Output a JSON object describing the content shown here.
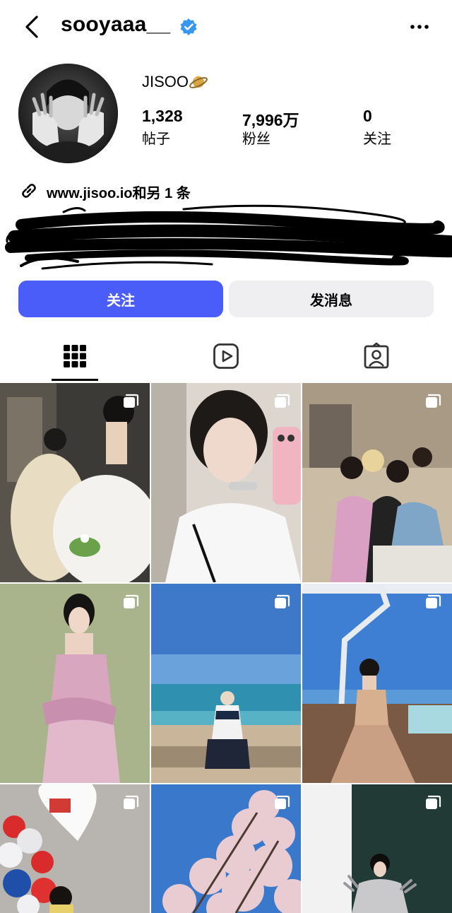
{
  "header": {
    "username": "sooyaaa__",
    "verified": true,
    "icons": [
      "back-arrow-icon",
      "verified-badge-icon",
      "more-options-icon"
    ]
  },
  "profile": {
    "display_name": "JISOO",
    "name_emoji_icon": "planet-icon",
    "stats": [
      {
        "value": "1,328",
        "label": "帖子"
      },
      {
        "value": "7,996万",
        "label": "粉丝"
      },
      {
        "value": "0",
        "label": "关注"
      }
    ],
    "link": "www.jisoo.io和另 1 条",
    "bio": ""
  },
  "actions": {
    "follow_label": "关注",
    "message_label": "发消息"
  },
  "colors": {
    "follow_button": "#4a5df9",
    "message_button": "#efeff2",
    "verified": "#3897f0"
  },
  "tabs": [
    {
      "icon": "grid-icon",
      "active": true
    },
    {
      "icon": "reels-icon",
      "active": false
    },
    {
      "icon": "tagged-icon",
      "active": false
    }
  ],
  "posts": [
    {
      "description": "woman in white gown with green handbag",
      "multi": true
    },
    {
      "description": "woman in white jacket taking mirror selfie",
      "multi": true
    },
    {
      "description": "group mirror selfie in restroom",
      "multi": true
    },
    {
      "description": "woman in pink floral dress on green background",
      "multi": true
    },
    {
      "description": "woman at beach with blue sea",
      "multi": true
    },
    {
      "description": "woman in pink gown on terrace",
      "multi": true
    },
    {
      "description": "heart balloons",
      "multi": true
    },
    {
      "description": "cherry blossoms against blue sky",
      "multi": true
    },
    {
      "description": "woman in dark feathered outfit",
      "multi": true
    }
  ]
}
